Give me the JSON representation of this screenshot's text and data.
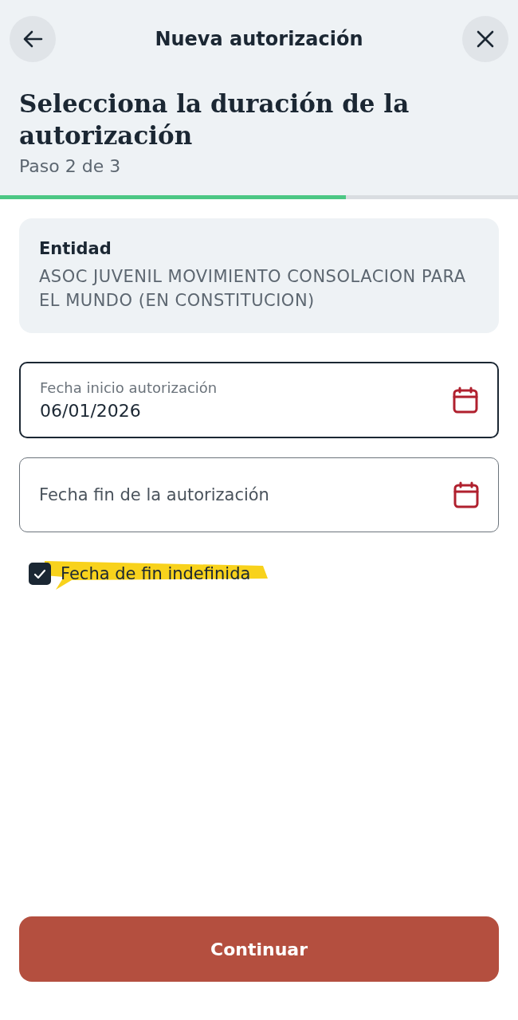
{
  "header": {
    "title": "Nueva autorización"
  },
  "step": {
    "heading": "Selecciona la duración de la autorización",
    "subtitle": "Paso 2 de 3",
    "level": 0.667
  },
  "entity": {
    "label": "Entidad",
    "value": "ASOC JUVENIL MOVIMIENTO CONSOLACION PARA EL MUNDO (EN CONSTITUCION)"
  },
  "fields": [
    {
      "label": "Fecha inicio autorización",
      "value": "06/01/2026",
      "focused": true
    },
    {
      "placeholder": "Fecha fin de la autorización",
      "focused": false
    }
  ],
  "checkbox": {
    "label": "Fecha de fin indefinida",
    "checked": true,
    "highlighted": true
  },
  "button": {
    "label": "Continuar"
  }
}
